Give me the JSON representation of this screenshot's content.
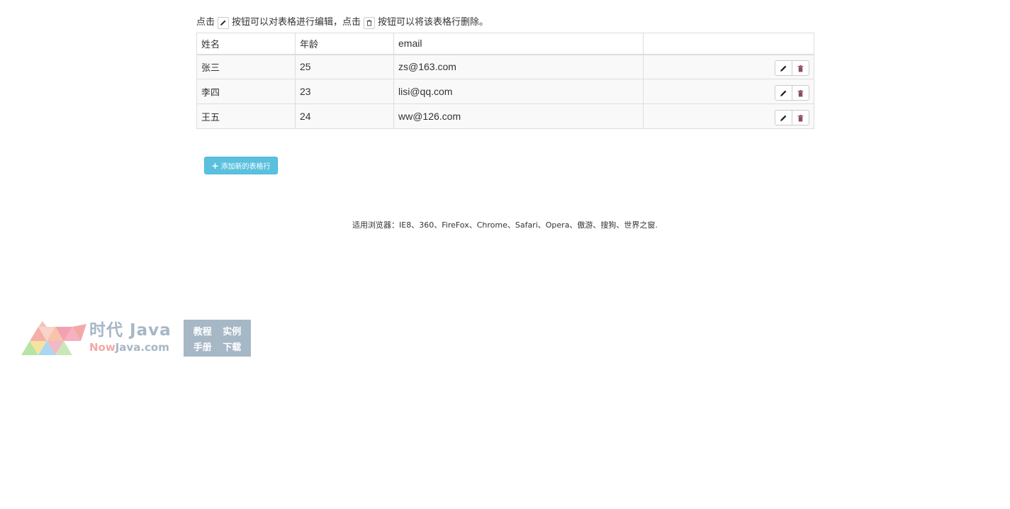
{
  "instructions": {
    "part1": "点击",
    "part2": "按钮可以对表格进行编辑，点击",
    "part3": "按钮可以将该表格行删除。"
  },
  "table": {
    "headers": [
      "姓名",
      "年龄",
      "email",
      ""
    ],
    "rows": [
      {
        "name": "张三",
        "age": "25",
        "email": "zs@163.com"
      },
      {
        "name": "李四",
        "age": "23",
        "email": "lisi@qq.com"
      },
      {
        "name": "王五",
        "age": "24",
        "email": "ww@126.com"
      }
    ]
  },
  "add_button": {
    "label": "添加新的表格行"
  },
  "footer": {
    "browsers": "适用浏览器：IE8、360、FireFox、Chrome、Safari、Opera、傲游、搜狗、世界之窗."
  },
  "logo": {
    "title": "时代 Java",
    "domain_now": "Now",
    "domain_rest": "Java.com",
    "links": [
      "教程",
      "实例",
      "手册",
      "下载"
    ]
  },
  "colors": {
    "info_button": "#5bc0de",
    "delete_icon": "#8e4a6a",
    "logo_gray": "#a6b7c6",
    "logo_pink": "#f3a8a8"
  }
}
